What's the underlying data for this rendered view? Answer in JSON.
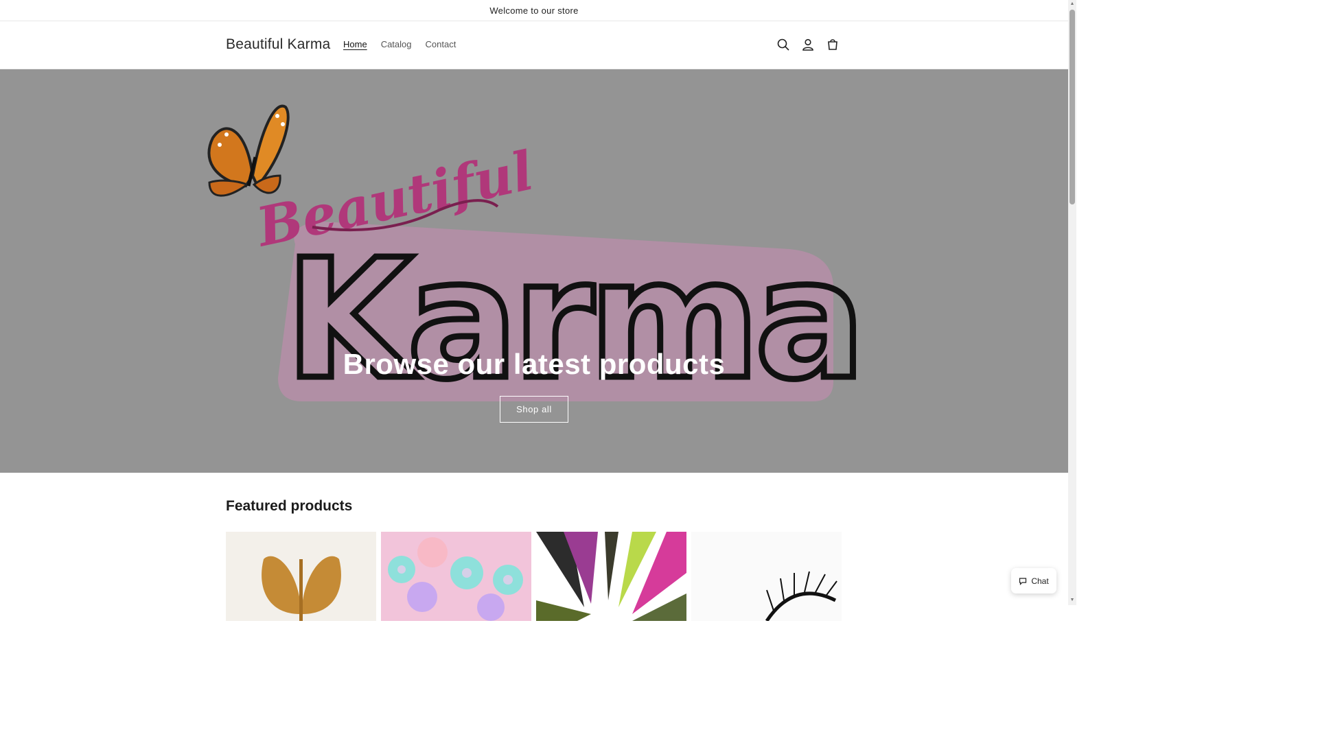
{
  "announcement": "Welcome to our store",
  "header": {
    "logo": "Beautiful Karma",
    "nav": [
      "Home",
      "Catalog",
      "Contact"
    ],
    "active_nav": "Home",
    "icons": [
      "search-icon",
      "account-icon",
      "cart-icon"
    ]
  },
  "hero": {
    "title": "Browse our latest products",
    "button": "Shop all",
    "banner_script": "Beautiful",
    "banner_word": "Karma"
  },
  "featured": {
    "title": "Featured products"
  },
  "chat": {
    "label": "Chat"
  },
  "colors": {
    "hero_bg": "#949494",
    "brand_pink": "#b0387a",
    "banner_pink": "#b48ea6"
  }
}
